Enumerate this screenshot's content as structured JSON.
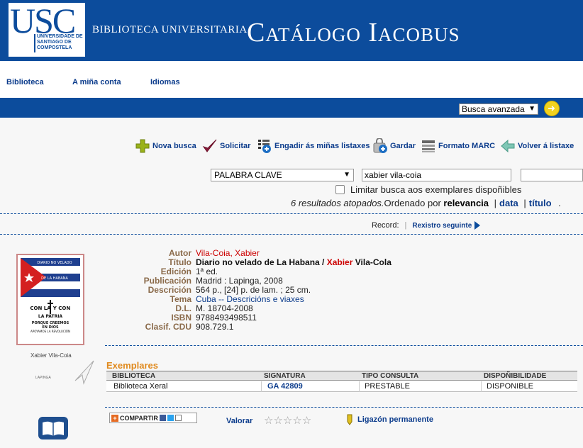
{
  "header": {
    "logo_text": "USC",
    "logo_subtitle": "UNIVERSIDADE DE SANTIAGO DE COMPOSTELA",
    "library_title": "BIBLIOTECA UNIVERSITARIA",
    "catalog_title": "Catálogo Iacobus"
  },
  "nav": {
    "items": [
      "Biblioteca",
      "A miña conta",
      "Idiomas"
    ]
  },
  "search_bar": {
    "mode_select": "Busca avanzada"
  },
  "toolbar": {
    "new_search": "Nova busca",
    "request": "Solicitar",
    "add_lists": "Engadir ás miñas listaxes",
    "save": "Gardar",
    "marc": "Formato MARC",
    "back": "Volver á listaxe"
  },
  "search": {
    "field_select": "PALABRA CLAVE",
    "query": "xabier vila-coia",
    "limit_label": "Limitar busca aos exemplares dispoñibles",
    "results_text": "6 resultados atopados.",
    "sorted_by": "Ordenado por",
    "sort_relevance": "relevancia",
    "sort_date": "data",
    "sort_title": "título",
    "sort_sep": "|",
    "end_dot": "."
  },
  "record_nav": {
    "label": "Record:",
    "next": "Rexistro seguinte"
  },
  "record": {
    "author_label": "Autor",
    "author": "Vila-Coia, Xabier",
    "title_label": "Título",
    "title_main": "Diario no velado de La Habana / ",
    "title_author_red": "Xabier",
    "title_author_rest": " Vila-Cola",
    "edition_label": "Edición",
    "edition": "1ª ed.",
    "publication_label": "Publicación",
    "publication": "Madrid : Lapinga, 2008",
    "description_label": "Descrición",
    "description": "564 p., [24] p. de lam. ; 25 cm.",
    "subject_label": "Tema",
    "subject": "Cuba -- Descricións e viaxes",
    "dl_label": "D.L.",
    "dl": "M. 18704-2008",
    "isbn_label": "ISBN",
    "isbn": "9788493498511",
    "cdu_label": "Clasif. CDU",
    "cdu": "908.729.1"
  },
  "cover": {
    "line1": "DIARIO NO VELADO",
    "line2": "DE LA HABANA",
    "line3": "CON LA",
    "line3b": "Y CON",
    "line4": "LA PATRIA",
    "line5": "PORQUE CREEMOS",
    "line6": "EN DIOS",
    "line7": "APOYAMOS LA REVOLUCIÓN",
    "caption": "Xabier Vila-Coia",
    "publisher": "LAPINGA"
  },
  "holdings": {
    "title": "Exemplares",
    "headers": [
      "BIBLIOTECA",
      "SIGNATURA",
      "TIPO CONSULTA",
      "DISPOÑIBILIDADE"
    ],
    "row": [
      "Biblioteca Xeral",
      "GA 42809",
      "PRESTABLE",
      "DISPONIBLE"
    ]
  },
  "footer": {
    "share": "COMPARTIR",
    "rate": "Valorar",
    "stars": "☆☆☆☆☆",
    "permalink": "Ligazón permanente"
  }
}
